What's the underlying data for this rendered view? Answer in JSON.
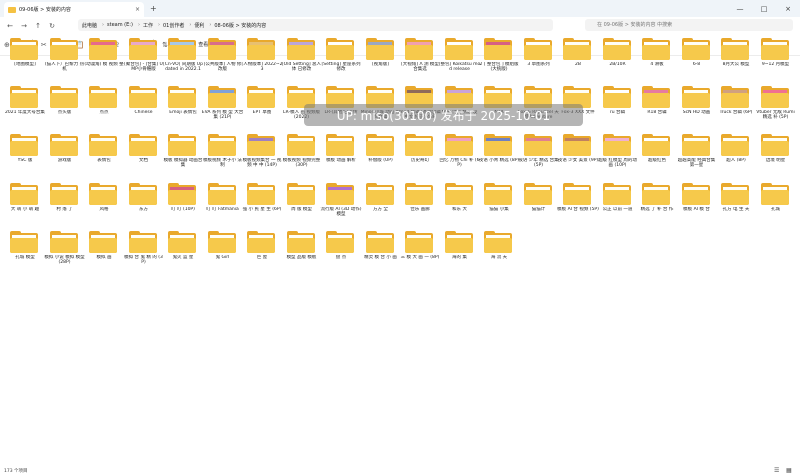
{
  "window": {
    "tab_title": "09-06版 > 安装的内容",
    "new_tab_glyph": "+",
    "close_glyph": "×",
    "minimize_glyph": "—",
    "maximize_glyph": "□"
  },
  "nav": {
    "back_icon": "arrow-left-icon",
    "forward_icon": "arrow-right-icon",
    "up_icon": "arrow-up-icon",
    "refresh_icon": "refresh-icon",
    "breadcrumbs": [
      "此电脑",
      "steam (E:)",
      "工作",
      "01创作者",
      "便利",
      "08-06版 > 安装的内容"
    ],
    "search_placeholder": "在 09-06版 > 安装的内容 中搜索"
  },
  "toolbar": {
    "new_label": "新建",
    "cut_icon": "cut-icon",
    "copy_icon": "copy-icon",
    "paste_icon": "paste-icon",
    "rename_icon": "rename-icon",
    "share_icon": "share-icon",
    "delete_icon": "delete-icon",
    "sort_label": "排序",
    "view_label": "查看",
    "more_glyph": "···"
  },
  "watermark_text": "UP: miso(30100) 发布于 2025-10-01",
  "status": {
    "count_text": "173 个项目"
  },
  "items": [
    {
      "label": "[地图模型]",
      "kind": "folder",
      "accent": "#f5c243"
    },
    {
      "label": "(猫人下）巴黎力 热机",
      "kind": "folder",
      "accent": "#ffffff"
    },
    {
      "label": "(动漫角) 模 视频 整",
      "kind": "folder",
      "accent": "#e56a8c"
    },
    {
      "label": "[聚合包] - [合集] UMP小骨骼版",
      "kind": "folder",
      "accent": "#e8a9c9"
    },
    {
      "label": "[Cn-VO] 同期版 Updated in 2022.1",
      "kind": "folder",
      "accent": "#a7c8e8"
    },
    {
      "label": "[公共版本] 人物 修改版",
      "kind": "folder",
      "accent": "#d86d8b"
    },
    {
      "label": "[人物版本] 2022~23",
      "kind": "folder",
      "accent": "#e8c070"
    },
    {
      "label": "[Old Setting] 总人体 已修改",
      "kind": "folder",
      "accent": "#bba6d9"
    },
    {
      "label": "[Setting] 星座系列修改",
      "kind": "folder",
      "accent": "#ffffff"
    },
    {
      "label": "[视角版]",
      "kind": "folder",
      "accent": "#9aa7c4"
    },
    {
      "label": "[大视角] Λ 测 模型合集选",
      "kind": "folder",
      "accent": "#f0a0b0"
    },
    {
      "label": "[整包] Koikatsu mod release",
      "kind": "folder",
      "accent": "#ffffff"
    },
    {
      "label": "2 [ 整合包 ] 模组版 (大统版)",
      "kind": "folder",
      "accent": "#d65f84"
    },
    {
      "label": "3 草图系列",
      "kind": "folder",
      "accent": "#ffffff"
    },
    {
      "label": "2B",
      "kind": "folder",
      "accent": "#f5c243"
    },
    {
      "label": "2B/10R",
      "kind": "folder",
      "accent": "#f5c243"
    },
    {
      "label": "4 滑板",
      "kind": "folder",
      "accent": "#ffffff"
    },
    {
      "label": "6-8",
      "kind": "folder",
      "accent": "#f5c243"
    },
    {
      "label": "8月大公 模型",
      "kind": "folder",
      "accent": "#f5c243"
    },
    {
      "label": "9~12 月模型",
      "kind": "folder",
      "accent": "#f5c243"
    },
    {
      "label": "2021 年度大号合集",
      "kind": "folder",
      "accent": "#f5c243"
    },
    {
      "label": "点头版",
      "kind": "folder",
      "accent": "#f5c243"
    },
    {
      "label": "点点",
      "kind": "folder",
      "accent": "#f5c243"
    },
    {
      "label": "Chinese",
      "kind": "folder",
      "accent": "#f5c243"
    },
    {
      "label": "Emoji 表情包",
      "kind": "folder",
      "accent": "#f5c243"
    },
    {
      "label": "EVA 系列 模 型 大合集 (21P)",
      "kind": "folder",
      "accent": "#7fa1d8"
    },
    {
      "label": "EPT 草图",
      "kind": "folder",
      "accent": "#f5c243"
    },
    {
      "label": "LR-模人 画 视频版 (2022)",
      "kind": "folder",
      "accent": "#f5c243"
    },
    {
      "label": "LR-(其他)已上传",
      "kind": "folder",
      "accent": "#f5c243"
    },
    {
      "label": "Minor 小城 动画 视频合辑",
      "kind": "folder",
      "accent": "#f5c243"
    },
    {
      "label": "mod 合辑 (基础合辑 中文 修正) 43P",
      "kind": "folder",
      "accent": "#8f6a5a"
    },
    {
      "label": "NISI 试完 精选 发",
      "kind": "folder",
      "accent": "#c9a3d9"
    },
    {
      "label": "NTR",
      "kind": "folder",
      "accent": "#f5c243"
    },
    {
      "label": "Fox & Rapunzel 天使Adventure",
      "kind": "folder",
      "accent": "#f5c243"
    },
    {
      "label": "Fox-3 XXX 文件",
      "kind": "folder",
      "accent": "#f5c243"
    },
    {
      "label": "ru 合辑",
      "kind": "folder",
      "accent": "#ffffff"
    },
    {
      "label": "R18 合辑",
      "kind": "folder",
      "accent": "#e67aa0"
    },
    {
      "label": "ScN HD 动画",
      "kind": "folder",
      "accent": "#f5c243"
    },
    {
      "label": "Truck 合辑 (6P)",
      "kind": "folder",
      "accent": "#d0a080"
    },
    {
      "label": "Vtuber 无敌 Rumi 精选 补 (5P)",
      "kind": "folder",
      "accent": "#f07090"
    },
    {
      "label": "YSC 版",
      "kind": "folder",
      "accent": "#f5c243"
    },
    {
      "label": "游戏版",
      "kind": "folder",
      "accent": "#f5c243"
    },
    {
      "label": "表情包",
      "kind": "folder",
      "accent": "#f5c243"
    },
    {
      "label": "文档",
      "kind": "folder",
      "accent": "#f5c243"
    },
    {
      "label": "模板 模拟器 动画合集",
      "kind": "folder",
      "accent": "#ffffff"
    },
    {
      "label": "模板视频 木子小 法制",
      "kind": "folder",
      "accent": "#f5c243"
    },
    {
      "label": "模板视频集合 一 视频 中 中 (14P)",
      "kind": "folder",
      "accent": "#a080c0"
    },
    {
      "label": "模板视频 视频完整 (30P)",
      "kind": "folder",
      "accent": "#f5c243"
    },
    {
      "label": "模板 动画 解析",
      "kind": "folder",
      "accent": "#ffffff"
    },
    {
      "label": "补偿版 (UP)",
      "kind": "folder",
      "accent": "#f5c243"
    },
    {
      "label": "历史奇幻",
      "kind": "folder",
      "accent": "#f5c243"
    },
    {
      "label": "回忆 万物 Chi 补 (6P)",
      "kind": "folder",
      "accent": "#f0a0c0"
    },
    {
      "label": "夜语 小青 精选 (8P)",
      "kind": "folder",
      "accent": "#7080c0"
    },
    {
      "label": "夜语 少年 精选 合集 (5P)",
      "kind": "folder",
      "accent": "#e08090"
    },
    {
      "label": "夜语 少女 美景 (9P)",
      "kind": "folder",
      "accent": "#c08060"
    },
    {
      "label": "超级 红模型 周的动 画 (10P)",
      "kind": "folder",
      "accent": "#f0b0d0"
    },
    {
      "label": "超级红色",
      "kind": "folder",
      "accent": "#ffffff"
    },
    {
      "label": "超越高能 经典合集 第一星",
      "kind": "folder",
      "accent": "#f5c243"
    },
    {
      "label": "超人 (8P)",
      "kind": "folder",
      "accent": "#f5c243"
    },
    {
      "label": "边境 明星",
      "kind": "folder",
      "accent": "#f5c243"
    },
    {
      "label": "大 萌 小 萌 趣",
      "kind": "folder",
      "accent": "#f5c243"
    },
    {
      "label": "村 落 了",
      "kind": "folder",
      "accent": "#f5c243"
    },
    {
      "label": "风格",
      "kind": "folder",
      "accent": "#f5c243"
    },
    {
      "label": "东方",
      "kind": "folder",
      "accent": "#f5c243"
    },
    {
      "label": "叮 叮 (10P)",
      "kind": "folder",
      "accent": "#d66080"
    },
    {
      "label": "叮 叮 Fatmania",
      "kind": "folder",
      "accent": "#f5c243"
    },
    {
      "label": "强 小 民 星 生 (6P)",
      "kind": "folder",
      "accent": "#f5c243"
    },
    {
      "label": "周 版 模型",
      "kind": "folder",
      "accent": "#f5c243"
    },
    {
      "label": "流行版 AI (3D 动作) 模型",
      "kind": "folder",
      "accent": "#b070d0"
    },
    {
      "label": "方方 全",
      "kind": "folder",
      "accent": "#f5c243"
    },
    {
      "label": "佳乐 画廊",
      "kind": "folder",
      "accent": "#f5c243"
    },
    {
      "label": "和东 大",
      "kind": "folder",
      "accent": "#f5c243"
    },
    {
      "label": "猫猫 小集",
      "kind": "folder",
      "accent": "#f5c243"
    },
    {
      "label": "猫猫计",
      "kind": "folder",
      "accent": "#f5c243"
    },
    {
      "label": "模板 AI 合 视频 (5P)",
      "kind": "folder",
      "accent": "#ffffff"
    },
    {
      "label": "公正 以前 一道",
      "kind": "folder",
      "accent": "#f5c243"
    },
    {
      "label": "精选 了 补 合 作",
      "kind": "folder",
      "accent": "#f5c243"
    },
    {
      "label": "模板 AI 模 合",
      "kind": "folder",
      "accent": "#f5c243"
    },
    {
      "label": "孔方 电 生 天",
      "kind": "folder",
      "accent": "#f5c243"
    },
    {
      "label": "孔城",
      "kind": "folder",
      "accent": "#f5c243"
    },
    {
      "label": "孔城 模型",
      "kind": "folder",
      "accent": "#f5c243"
    },
    {
      "label": "模拟 小说 模拟 模型 (28P)",
      "kind": "folder",
      "accent": "#f5c243"
    },
    {
      "label": "模拟 画",
      "kind": "folder",
      "accent": "#f5c243"
    },
    {
      "label": "模拟 合 鬼 精 的 (3P)",
      "kind": "folder",
      "accent": "#f5c243"
    },
    {
      "label": "鬼火 蓝 星",
      "kind": "folder",
      "accent": "#f5c243"
    },
    {
      "label": "鬼 Girl",
      "kind": "folder",
      "accent": "#f5c243"
    },
    {
      "label": "巨 屋",
      "kind": "folder",
      "accent": "#f5c243"
    },
    {
      "label": "模型 品版 模板",
      "kind": "folder",
      "accent": "#f5c243"
    },
    {
      "label": "盘 点",
      "kind": "folder",
      "accent": "#f5c243"
    },
    {
      "label": "精灵 模 合 小 画",
      "kind": "folder",
      "accent": "#f5c243"
    },
    {
      "label": "三 模 大 画 一 (8P)",
      "kind": "folder",
      "accent": "#f5c243"
    },
    {
      "label": "海的 集",
      "kind": "folder",
      "accent": "#f5c243"
    },
    {
      "label": "海 流 天",
      "kind": "folder",
      "accent": "#f5c243"
    }
  ]
}
